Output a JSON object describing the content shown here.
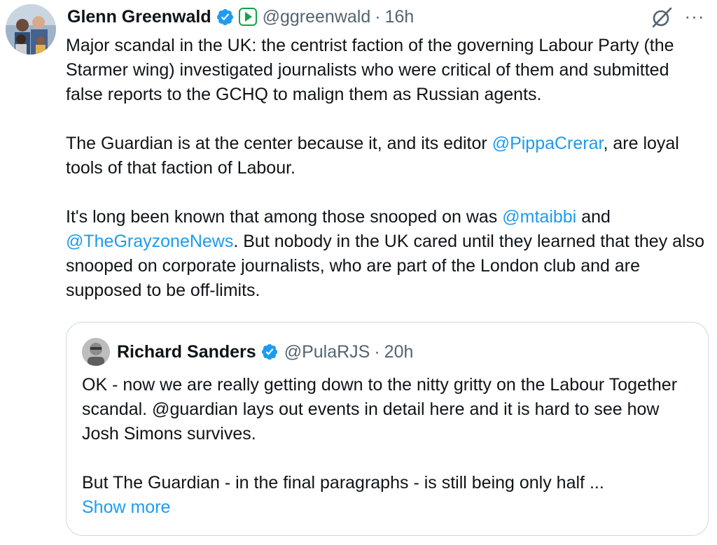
{
  "tweet": {
    "author_name": "Glenn Greenwald",
    "handle": "@ggreenwald",
    "separator": "·",
    "time": "16h",
    "paragraph1": "Major scandal in the UK: the centrist faction of the governing Labour Party (the Starmer wing) investigated journalists who were critical of them and submitted false reports to the GCHQ to malign them as Russian agents.",
    "p2_before": "The Guardian is at the center because it, and its editor ",
    "p2_mention": "@PippaCrerar",
    "p2_after": ", are loyal tools of that faction of Labour.",
    "p3_before": "It's long been known that among those snooped on was ",
    "p3_mention1": "@mtaibbi",
    "p3_mid": " and ",
    "p3_mention2": "@TheGrayzoneNews",
    "p3_after": ". But nobody in the UK cared until they learned that they also snooped on corporate journalists, who are part of the London club and are supposed to be off-limits."
  },
  "quote": {
    "author_name": "Richard Sanders",
    "handle": "@PulaRJS",
    "separator": "·",
    "time": "20h",
    "paragraph1": "OK - now we are really getting down to the nitty gritty on the Labour Together scandal. @guardian lays out events in detail here and it is hard to see how Josh Simons survives.",
    "paragraph2": "But The Guardian - in the final paragraphs - is still being only half ...",
    "show_more": "Show more"
  },
  "icons": {
    "verified": "verified-badge-icon",
    "affiliate": "play-affiliate-icon",
    "grok": "grok-icon",
    "more": "more-options-icon"
  },
  "colors": {
    "accent": "#1d9bf0",
    "secondary_text": "#536471",
    "affiliate_green": "#16a34a",
    "border": "#cfd9de"
  },
  "more_glyph": "···"
}
